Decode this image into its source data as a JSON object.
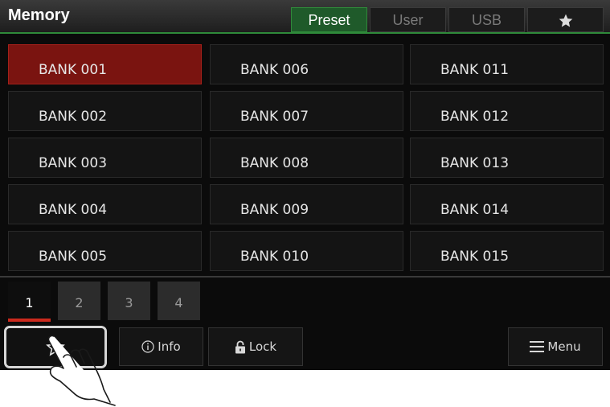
{
  "header": {
    "title": "Memory",
    "tabs": [
      {
        "label": "Preset",
        "active": true
      },
      {
        "label": "User",
        "active": false
      },
      {
        "label": "USB",
        "active": false
      },
      {
        "icon": "star-icon",
        "active": false
      }
    ]
  },
  "banks": [
    {
      "label": "BANK 001",
      "selected": true
    },
    {
      "label": "BANK 002"
    },
    {
      "label": "BANK 003"
    },
    {
      "label": "BANK 004"
    },
    {
      "label": "BANK 005"
    },
    {
      "label": "BANK 006"
    },
    {
      "label": "BANK 007"
    },
    {
      "label": "BANK 008"
    },
    {
      "label": "BANK 009"
    },
    {
      "label": "BANK 010"
    },
    {
      "label": "BANK 011"
    },
    {
      "label": "BANK 012"
    },
    {
      "label": "BANK 013"
    },
    {
      "label": "BANK 014"
    },
    {
      "label": "BANK 015"
    }
  ],
  "pages": [
    {
      "label": "1",
      "active": true
    },
    {
      "label": "2"
    },
    {
      "label": "3"
    },
    {
      "label": "4"
    }
  ],
  "footer": {
    "favorite_icon": "star-plus-icon",
    "info_label": "Info",
    "info_icon": "info-icon",
    "lock_label": "Lock",
    "lock_icon": "lock-icon",
    "menu_label": "Menu",
    "menu_icon": "menu-icon"
  },
  "colors": {
    "accent_green": "#2f8a3a",
    "selected_red": "#7a1410",
    "page_indicator": "#cc2a1e"
  }
}
